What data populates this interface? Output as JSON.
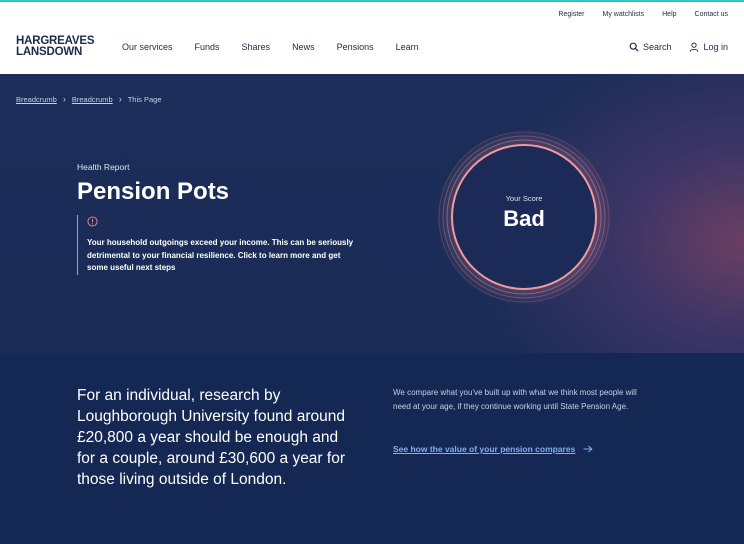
{
  "util_nav": [
    "Register",
    "My watchlists",
    "Help",
    "Contact us"
  ],
  "logo": {
    "line1": "HARGREAVES",
    "line2": "LANSDOWN"
  },
  "main_nav": [
    "Our services",
    "Funds",
    "Shares",
    "News",
    "Pensions",
    "Learn"
  ],
  "right_nav": {
    "search": "Search",
    "login": "Log in"
  },
  "breadcrumb": {
    "items": [
      "Breadcrumb",
      "Breadcrumb"
    ],
    "current": "This Page"
  },
  "hero": {
    "eyebrow": "Health Report",
    "title": "Pension Pots",
    "alert": "Your household outgoings exceed your income. This can be seriously detrimental to your financial resilience. Click to learn more and get some useful next steps"
  },
  "score": {
    "label": "Your Score",
    "value": "Bad"
  },
  "lower": {
    "quote": "For an individual, research by Loughborough University found around £20,800 a year should be enough and for a couple, around £30,600 a year for those living outside of London.",
    "compare_text": "We compare what you've built up with what we think most people will need at your age, if they continue working until State Pension Age.",
    "compare_link": "See how the value of your pension compares"
  },
  "colors": {
    "accent": "#2cc8c0",
    "alert": "#e8878c",
    "link": "#7fb0f0",
    "brand_text": "#1b2a4a"
  },
  "icons": [
    "search-icon",
    "user-icon",
    "alert-circle-icon",
    "chevron-right-icon",
    "arrow-right-icon"
  ]
}
